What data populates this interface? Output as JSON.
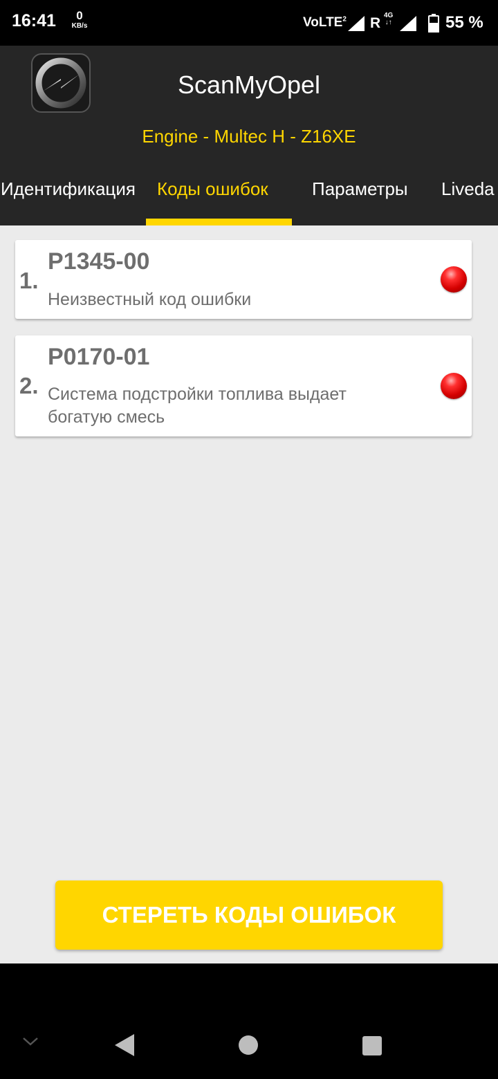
{
  "status_bar": {
    "time": "16:41",
    "net_speed_value": "0",
    "net_speed_unit": "KB/s",
    "volte": "VoLTE",
    "volte_sim": "2",
    "roaming": "R",
    "network_type": "4G",
    "battery": "55 %"
  },
  "app": {
    "title": "ScanMyOpel",
    "subtitle": "Engine - Multec H - Z16XE"
  },
  "tabs": [
    {
      "label": "Идентификация",
      "active": false
    },
    {
      "label": "Коды ошибок",
      "active": true
    },
    {
      "label": "Параметры",
      "active": false
    },
    {
      "label": "Liveda",
      "active": false
    }
  ],
  "faults": [
    {
      "index": "1.",
      "code": "P1345-00",
      "description": "Неизвестный код ошибки",
      "status_icon": "red-led-icon"
    },
    {
      "index": "2.",
      "code": "P0170-01",
      "description": "Система подстройки топлива выдает богатую смесь",
      "status_icon": "red-led-icon"
    }
  ],
  "clear_button": {
    "label": "СТЕРЕТЬ КОДЫ ОШИБОК"
  },
  "nav": {
    "items": [
      "chevron-down-icon",
      "back-icon",
      "home-icon",
      "recents-icon"
    ]
  },
  "colors": {
    "accent": "#ffd600",
    "header_bg": "#262626",
    "content_bg": "#ebebeb",
    "led": "#d40000"
  }
}
